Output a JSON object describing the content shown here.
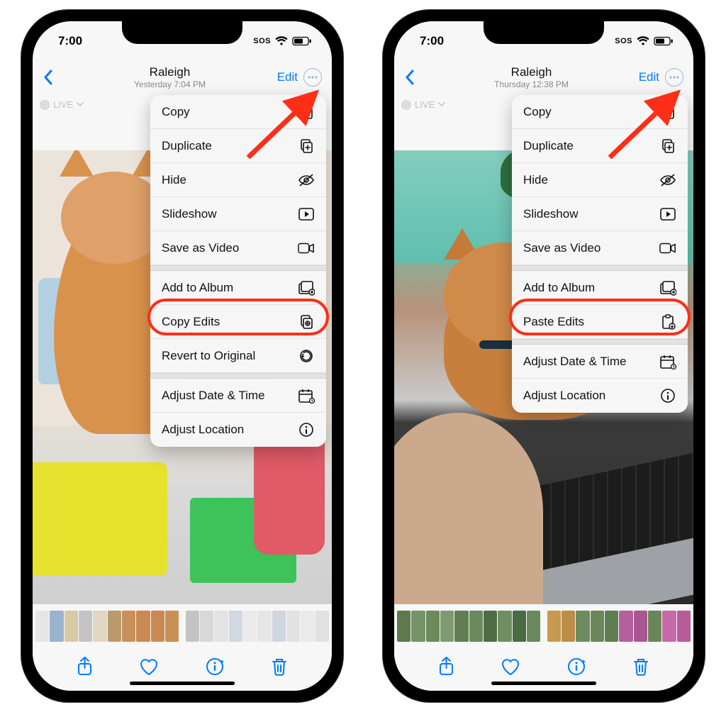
{
  "colors": {
    "ios_blue": "#007aff",
    "highlight": "#ff2e17"
  },
  "phones": [
    {
      "status": {
        "time": "7:00",
        "sos": "SOS"
      },
      "nav": {
        "title": "Raleigh",
        "subtitle": "Yesterday  7:04 PM",
        "edit": "Edit"
      },
      "live_badge": "LIVE",
      "menu_groups": [
        [
          {
            "label": "Copy",
            "icon": "copy-doc-icon"
          },
          {
            "label": "Duplicate",
            "icon": "duplicate-icon"
          },
          {
            "label": "Hide",
            "icon": "eye-slash-icon"
          },
          {
            "label": "Slideshow",
            "icon": "play-rect-icon"
          },
          {
            "label": "Save as Video",
            "icon": "video-icon"
          }
        ],
        [
          {
            "label": "Add to Album",
            "icon": "album-add-icon"
          },
          {
            "label": "Copy Edits",
            "icon": "copy-edits-icon"
          },
          {
            "label": "Revert to Original",
            "icon": "revert-icon"
          }
        ],
        [
          {
            "label": "Adjust Date & Time",
            "icon": "calendar-icon"
          },
          {
            "label": "Adjust Location",
            "icon": "info-icon"
          }
        ]
      ],
      "highlight_label": "Copy Edits",
      "scrubber_palette": [
        "#e5e5e5",
        "#9ab4d0",
        "#d7c9a5",
        "#c4c4c4",
        "#e0d6c3",
        "#b89a6c",
        "#c7905d",
        "#c88a52",
        "#c88a52",
        "#ca8f57",
        "#c4c4c4",
        "#d8d8d8",
        "#e3e3e3",
        "#d0d8e2",
        "#eaeaea",
        "#e6e6e6",
        "#cfd6df",
        "#e2e2e2",
        "#eaeaea",
        "#e1e1e1"
      ]
    },
    {
      "status": {
        "time": "7:00",
        "sos": "SOS"
      },
      "nav": {
        "title": "Raleigh",
        "subtitle": "Thursday  12:38 PM",
        "edit": "Edit"
      },
      "live_badge": "LIVE",
      "menu_groups": [
        [
          {
            "label": "Copy",
            "icon": "copy-doc-icon"
          },
          {
            "label": "Duplicate",
            "icon": "duplicate-icon"
          },
          {
            "label": "Hide",
            "icon": "eye-slash-icon"
          },
          {
            "label": "Slideshow",
            "icon": "play-rect-icon"
          },
          {
            "label": "Save as Video",
            "icon": "video-icon"
          }
        ],
        [
          {
            "label": "Add to Album",
            "icon": "album-add-icon"
          },
          {
            "label": "Paste Edits",
            "icon": "paste-edits-icon"
          }
        ],
        [
          {
            "label": "Adjust Date & Time",
            "icon": "calendar-icon"
          },
          {
            "label": "Adjust Location",
            "icon": "info-icon"
          }
        ]
      ],
      "highlight_label": "Paste Edits",
      "scrubber_palette": [
        "#5c7a4c",
        "#74946a",
        "#6c8a5a",
        "#7f9a70",
        "#5f7e52",
        "#6b8a5b",
        "#4e6c46",
        "#6f8f63",
        "#4a6a44",
        "#6a885c",
        "#c79a52",
        "#bb8d49",
        "#6e8b5d",
        "#6a875b",
        "#5e7d50",
        "#b55f9b",
        "#a85792",
        "#68865a",
        "#c66aa9",
        "#b65d9a"
      ]
    }
  ]
}
